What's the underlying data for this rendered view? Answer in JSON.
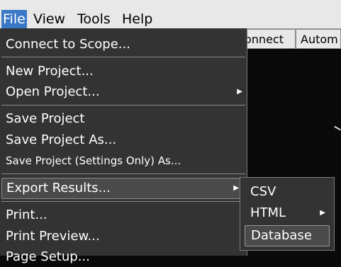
{
  "menubar": {
    "items": [
      {
        "label": "File"
      },
      {
        "label": "View"
      },
      {
        "label": "Tools"
      },
      {
        "label": "Help"
      }
    ]
  },
  "tabs": [
    {
      "label": "onnect"
    },
    {
      "label": "Autom"
    }
  ],
  "file_menu": {
    "items": [
      {
        "label": "Connect to Scope..."
      },
      {
        "label": "New Project..."
      },
      {
        "label": "Open Project..."
      },
      {
        "label": "Save Project"
      },
      {
        "label": "Save Project As..."
      },
      {
        "label": "Save Project (Settings Only) As..."
      },
      {
        "label": "Export Results..."
      },
      {
        "label": "Print..."
      },
      {
        "label": "Print Preview..."
      },
      {
        "label": "Page Setup..."
      }
    ]
  },
  "export_submenu": {
    "items": [
      {
        "label": "CSV"
      },
      {
        "label": "HTML"
      },
      {
        "label": "Database"
      }
    ]
  },
  "colors": {
    "menu_bg": "#333333",
    "highlight_bg": "#4a4a4a",
    "menubar_active": "#3a78c6"
  }
}
